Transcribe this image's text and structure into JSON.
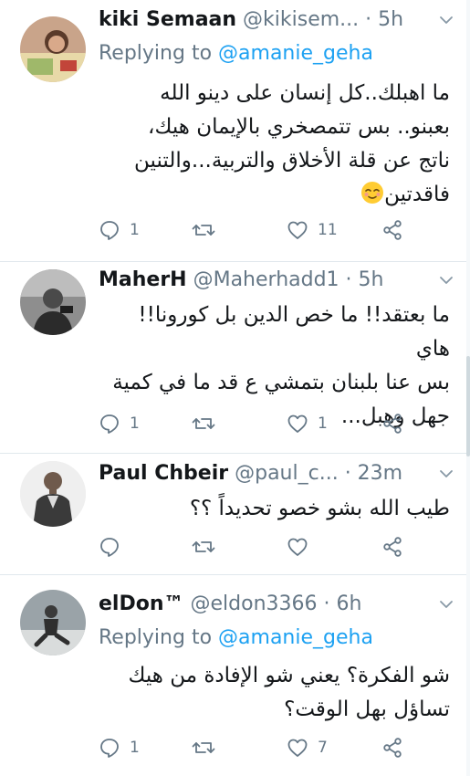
{
  "tweets": [
    {
      "display_name": "kiki Semaan",
      "handle": "@kikisem...",
      "time": "· 5h",
      "replying_to_label": "Replying to",
      "replying_to_handle": "@amanie_geha",
      "body_lines": [
        "ما اهبلك..كل إنسان على دينو الله",
        "بعبنو.. بس تتمصخري بالإيمان هيك،",
        "ناتج عن قلة الأخلاق والتربية...والتنين",
        "فاقدتين"
      ],
      "emoji": "relieved-face-emoji",
      "replies": "1",
      "retweets": "",
      "likes": "11"
    },
    {
      "display_name": "MaherH",
      "handle": "@Maherhadd1",
      "time": "· 5h",
      "body_lines": [
        "ما بعتقد!! ما خص الدين بل كورونا!! هاي",
        "بس عنا بلبنان بتمشي ع قد ما في كمية",
        "جهل وهبل..."
      ],
      "replies": "1",
      "retweets": "",
      "likes": "1"
    },
    {
      "display_name": "Paul Chbeir",
      "handle": "@paul_c...",
      "time": "· 23m",
      "body_lines": [
        "طيب الله بشو خصو تحديداً ؟؟"
      ],
      "replies": "",
      "retweets": "",
      "likes": ""
    },
    {
      "display_name": "elDon™",
      "handle": "@eldon3366",
      "time": "· 6h",
      "replying_to_label": "Replying to",
      "replying_to_handle": "@amanie_geha",
      "body_lines": [
        "شو الفكرة؟ يعني شو الإفادة من هيك",
        "تساؤل بهل الوقت؟"
      ],
      "replies": "1",
      "retweets": "",
      "likes": "7"
    }
  ],
  "icons": {
    "reply": "reply-icon",
    "retweet": "retweet-icon",
    "like": "heart-icon",
    "share": "share-icon",
    "caret": "chevron-down-icon"
  },
  "colors": {
    "text": "#14171a",
    "secondary": "#657786",
    "link": "#1da1f2",
    "separator": "#e1e8ed"
  }
}
